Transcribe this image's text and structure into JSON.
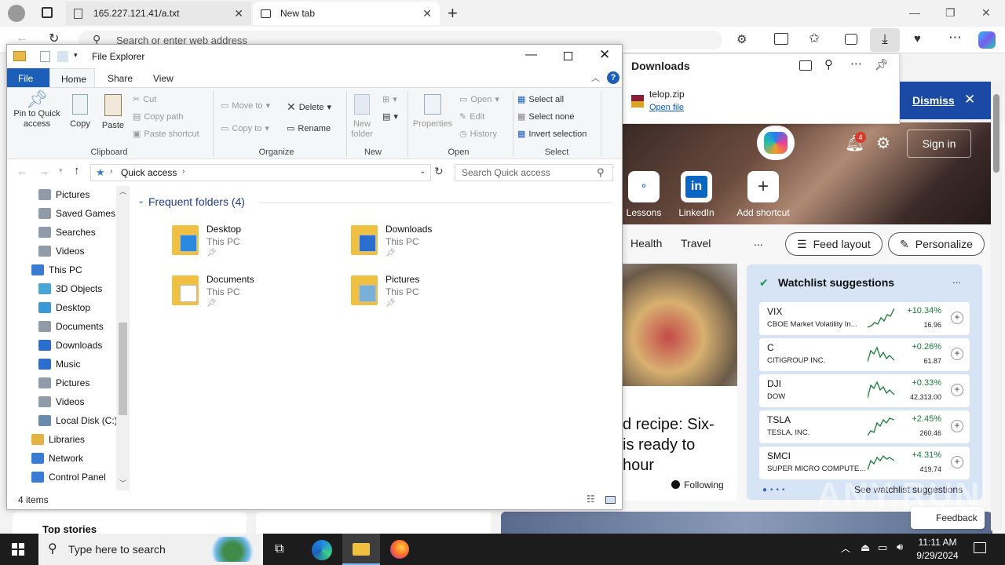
{
  "browser": {
    "tabs": [
      {
        "label": "165.227.121.41/a.txt",
        "active": false
      },
      {
        "label": "New tab",
        "active": true
      }
    ],
    "address_placeholder": "Search or enter web address",
    "downloads": {
      "title": "Downloads",
      "file": "telop.zip",
      "open_file": "Open file"
    },
    "dismiss": "Dismiss",
    "sign_in": "Sign in",
    "notification_count": "4",
    "shortcuts": [
      {
        "label": "Lessons"
      },
      {
        "label": "LinkedIn"
      },
      {
        "label": "Add shortcut"
      }
    ],
    "feed_tabs": [
      "Health",
      "Travel",
      "..."
    ],
    "feed_layout": "Feed layout",
    "personalize": "Personalize",
    "article": {
      "line1": "d recipe: Six-",
      "line2": "is ready to",
      "line3": "hour",
      "following": "Following"
    },
    "watchlist": {
      "title": "Watchlist suggestions",
      "more": "...",
      "rows": [
        {
          "symbol": "VIX",
          "name": "CBOE Market Volatility In...",
          "change": "+10.34%",
          "price": "16.96"
        },
        {
          "symbol": "C",
          "name": "CITIGROUP INC.",
          "change": "+0.26%",
          "price": "61.87"
        },
        {
          "symbol": "DJI",
          "name": "DOW",
          "change": "+0.33%",
          "price": "42,313.00"
        },
        {
          "symbol": "TSLA",
          "name": "TESLA, INC.",
          "change": "+2.45%",
          "price": "260.46"
        },
        {
          "symbol": "SMCI",
          "name": "SUPER MICRO COMPUTE...",
          "change": "+4.31%",
          "price": "419.74"
        }
      ],
      "see_more": "See watchlist suggestions"
    },
    "top_stories": "Top stories",
    "feedback": "Feedback",
    "watermark": "ANY.RUN"
  },
  "explorer": {
    "title": "File Explorer",
    "menu_tabs": {
      "file": "File",
      "home": "Home",
      "share": "Share",
      "view": "View"
    },
    "ribbon": {
      "pin": "Pin to Quick access",
      "copy": "Copy",
      "paste": "Paste",
      "cut": "Cut",
      "copy_path": "Copy path",
      "paste_shortcut": "Paste shortcut",
      "clipboard": "Clipboard",
      "move_to": "Move to",
      "copy_to": "Copy to",
      "delete": "Delete",
      "rename": "Rename",
      "organize": "Organize",
      "new_folder": "New folder",
      "new": "New",
      "properties": "Properties",
      "open": "Open",
      "edit": "Edit",
      "history": "History",
      "open_group": "Open",
      "select_all": "Select all",
      "select_none": "Select none",
      "invert_selection": "Invert selection",
      "select": "Select"
    },
    "breadcrumb": "Quick access",
    "search_placeholder": "Search Quick access",
    "nav_items": [
      {
        "label": "Pictures",
        "indent": 1,
        "icon": "pictures-icon"
      },
      {
        "label": "Saved Games",
        "indent": 1,
        "icon": "saved-games-icon"
      },
      {
        "label": "Searches",
        "indent": 1,
        "icon": "searches-icon"
      },
      {
        "label": "Videos",
        "indent": 1,
        "icon": "videos-icon"
      },
      {
        "label": "This PC",
        "indent": 0,
        "icon": "this-pc-icon"
      },
      {
        "label": "3D Objects",
        "indent": 1,
        "icon": "3d-objects-icon"
      },
      {
        "label": "Desktop",
        "indent": 1,
        "icon": "desktop-icon"
      },
      {
        "label": "Documents",
        "indent": 1,
        "icon": "documents-icon"
      },
      {
        "label": "Downloads",
        "indent": 1,
        "icon": "downloads-icon"
      },
      {
        "label": "Music",
        "indent": 1,
        "icon": "music-icon"
      },
      {
        "label": "Pictures",
        "indent": 1,
        "icon": "pictures-icon"
      },
      {
        "label": "Videos",
        "indent": 1,
        "icon": "videos-icon"
      },
      {
        "label": "Local Disk (C:)",
        "indent": 1,
        "icon": "disk-icon"
      },
      {
        "label": "Libraries",
        "indent": 0,
        "icon": "libraries-icon"
      },
      {
        "label": "Network",
        "indent": 0,
        "icon": "network-icon"
      },
      {
        "label": "Control Panel",
        "indent": 0,
        "icon": "control-panel-icon"
      }
    ],
    "frequent_header": "Frequent folders (4)",
    "folders": [
      {
        "name": "Desktop",
        "location": "This PC"
      },
      {
        "name": "Downloads",
        "location": "This PC"
      },
      {
        "name": "Documents",
        "location": "This PC"
      },
      {
        "name": "Pictures",
        "location": "This PC"
      }
    ],
    "status": "4 items"
  },
  "taskbar": {
    "search_placeholder": "Type here to search",
    "time": "11:11 AM",
    "date": "9/29/2024"
  },
  "colors": {
    "accent_blue": "#1c5fb8",
    "stock_green": "#1b7a3c",
    "dismiss_bg": "#1a4aa6"
  }
}
